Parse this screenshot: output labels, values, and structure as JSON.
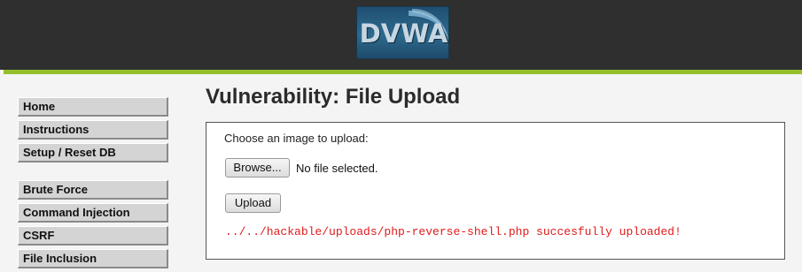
{
  "header": {
    "logo_text": "DVWA"
  },
  "menu": {
    "items": [
      {
        "label": "Home"
      },
      {
        "label": "Instructions"
      },
      {
        "label": "Setup / Reset DB"
      },
      {
        "label": "Brute Force"
      },
      {
        "label": "Command Injection"
      },
      {
        "label": "CSRF"
      },
      {
        "label": "File Inclusion"
      }
    ]
  },
  "main": {
    "title": "Vulnerability: File Upload",
    "prompt": "Choose an image to upload:",
    "browse_label": "Browse...",
    "file_status": "No file selected.",
    "upload_label": "Upload",
    "result_message": "../../hackable/uploads/php-reverse-shell.php succesfully uploaded!"
  },
  "colors": {
    "header_bg": "#2f2f2f",
    "accent_green": "#93c02a",
    "error_red": "#e01b1b",
    "page_bg": "#f4f4f4"
  }
}
